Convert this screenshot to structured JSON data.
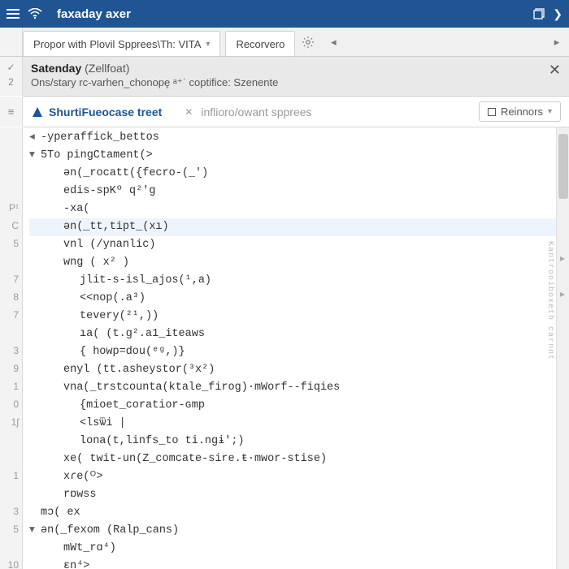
{
  "titlebar": {
    "title": "faxaday axer"
  },
  "tabs": {
    "primary": "Propor with Plovil Spprees\\Th: VITA",
    "secondary": "Recorvero"
  },
  "status": {
    "name": "Satenday",
    "paren": "(Zellfoat)",
    "subtitle": "Ons/stary rc-varhen_chonopę ᵃ⁺ˈ coptifice: Szenente"
  },
  "subtabs": {
    "active": "ShurtiFueocase treet",
    "inactive": "inflioro/owant spprees",
    "dropdown": "Reinnors"
  },
  "gutter_top": [
    "",
    "2"
  ],
  "gutter_status": [
    "✓",
    "2"
  ],
  "gutter_subtab": "≡",
  "code": {
    "lines": [
      {
        "g": "",
        "fold": "◂",
        "indent": 0,
        "text": "-yperaffick_bettos"
      },
      {
        "g": "",
        "fold": "▾",
        "indent": 0,
        "text": "5To pingCtament(>"
      },
      {
        "g": "",
        "fold": "",
        "indent": 1,
        "text": "ən(_rocatt({fecro-(_')"
      },
      {
        "g": "",
        "fold": "",
        "indent": 1,
        "text": "edis-spKº q²'g"
      },
      {
        "g": "P¹",
        "fold": "",
        "indent": 1,
        "text": "-xa("
      },
      {
        "g": "C",
        "fold": "",
        "indent": 1,
        "text": "ən(_tt,tipt_(xı)",
        "hl": true
      },
      {
        "g": "5",
        "fold": "",
        "indent": 1,
        "text": "vnl (/ynanlic)"
      },
      {
        "g": "",
        "fold": "",
        "indent": 1,
        "text": "wng ( x² )",
        "marker": "▸"
      },
      {
        "g": "7",
        "fold": "",
        "indent": 2,
        "text": "jlit-s-isl_ajos(¹,a)"
      },
      {
        "g": "8",
        "fold": "",
        "indent": 2,
        "text": "<<nop(.a³)",
        "marker": "▸"
      },
      {
        "g": "7",
        "fold": "",
        "indent": 2,
        "text": "tevery(²¹,))"
      },
      {
        "g": "",
        "fold": "",
        "indent": 2,
        "text": "ıa( (t.g².a1_iteaws"
      },
      {
        "g": "3",
        "fold": "",
        "indent": 2,
        "text": "{ howp=dou(ᵉᵍ,)}"
      },
      {
        "g": "9",
        "fold": "",
        "indent": 1,
        "text": "enyl (tt.asheystor(³x²)"
      },
      {
        "g": "1",
        "fold": "",
        "indent": 1,
        "text": "vna(_trstcounta(ktale_firog)·mWorf--fiqies"
      },
      {
        "g": "0",
        "fold": "",
        "indent": 2,
        "text": "{mioet_coratior-ɢmp"
      },
      {
        "g": "1ʃ",
        "fold": "",
        "indent": 2,
        "text": "<lsѿi |"
      },
      {
        "g": "",
        "fold": "",
        "indent": 2,
        "text": "lona(t,linfs_to ti.ngɨ';)"
      },
      {
        "g": "",
        "fold": "",
        "indent": 1,
        "text": "xe( twit-un(Z_comcate-sire.ŧ·mwor-stise)"
      },
      {
        "g": "1",
        "fold": "",
        "indent": 1,
        "text": "xɾe(ᴼ>"
      },
      {
        "g": "",
        "fold": "",
        "indent": 1,
        "text": "rɒwss"
      },
      {
        "g": "3",
        "fold": "",
        "indent": 0,
        "text": "mɔ( ex"
      },
      {
        "g": "5",
        "fold": "▾",
        "indent": 0,
        "text": "ən(_fexom (Ralp_cans)"
      },
      {
        "g": "",
        "fold": "",
        "indent": 1,
        "text": "mWt_rɑ⁴)"
      },
      {
        "g": "10",
        "fold": "",
        "indent": 1,
        "text": "ɛn⁴>"
      }
    ]
  },
  "side_label": "Kantroniboxeth carnnt"
}
